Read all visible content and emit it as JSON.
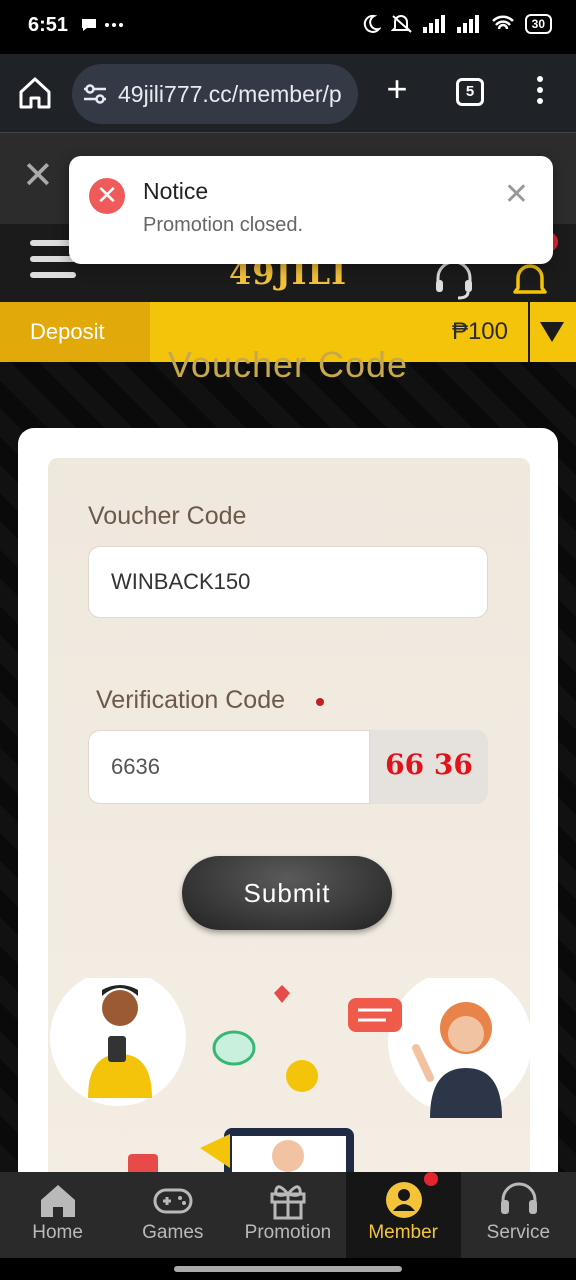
{
  "status_bar": {
    "time": "6:51",
    "left_icons": [
      "chat-bubble-icon",
      "more-dots-icon"
    ],
    "battery": "30"
  },
  "browser": {
    "url": "49jili777.cc/member/p",
    "tab_count": "5"
  },
  "header": {
    "logo_text": "49JILI"
  },
  "deposit_bar": {
    "deposit_label": "Deposit",
    "balance": "₱100"
  },
  "page": {
    "heading": "Voucher Code"
  },
  "form": {
    "voucher_label": "Voucher Code",
    "voucher_value": "WINBACK150",
    "verification_label": "Verification Code",
    "verification_value": "6636",
    "captcha_text": "66 36",
    "submit_label": "Submit"
  },
  "notice": {
    "title": "Notice",
    "message": "Promotion closed."
  },
  "bottom_nav": {
    "items": [
      {
        "label": "Home",
        "icon": "home-icon"
      },
      {
        "label": "Games",
        "icon": "gamepad-icon"
      },
      {
        "label": "Promotion",
        "icon": "gift-icon"
      },
      {
        "label": "Member",
        "icon": "member-icon",
        "active": true
      },
      {
        "label": "Service",
        "icon": "headset-icon"
      }
    ]
  },
  "colors": {
    "accent_yellow": "#f4c40a",
    "deposit_orange": "#e2a90a",
    "active_nav": "#f3c43a",
    "error_red": "#ef5a5a"
  }
}
